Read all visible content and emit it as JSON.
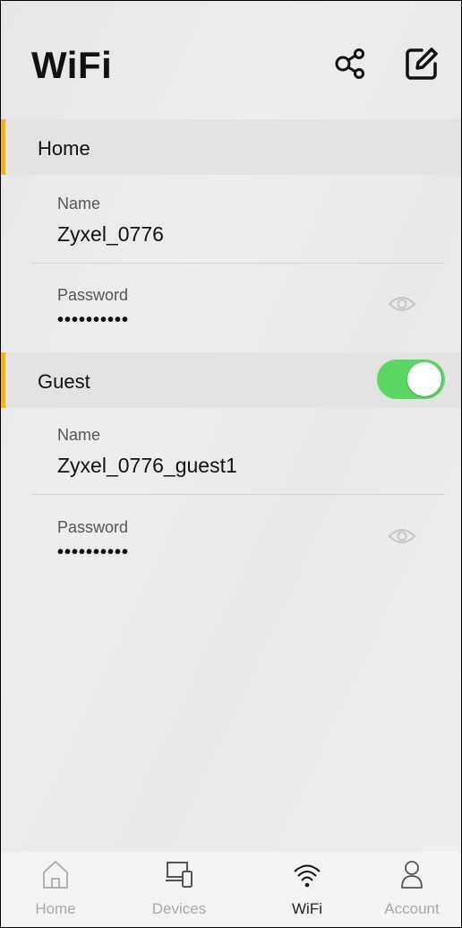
{
  "header": {
    "title": "WiFi",
    "icons": [
      "share-icon",
      "edit-icon"
    ]
  },
  "sections": [
    {
      "label": "Home",
      "name_label": "Name",
      "name_value": "Zyxel_0776",
      "password_label": "Password",
      "password_value": "••••••••••"
    },
    {
      "label": "Guest",
      "toggle_on": true,
      "name_label": "Name",
      "name_value": "Zyxel_0776_guest1",
      "password_label": "Password",
      "password_value": "••••••••••"
    }
  ],
  "nav": [
    {
      "label": "Home",
      "icon": "home-icon"
    },
    {
      "label": "Devices",
      "icon": "devices-icon"
    },
    {
      "label": "WiFi",
      "icon": "wifi-icon",
      "active": true
    },
    {
      "label": "Account",
      "icon": "account-icon"
    }
  ],
  "colors": {
    "accent_bar": "#f4b400",
    "toggle_on": "#5cd663"
  }
}
